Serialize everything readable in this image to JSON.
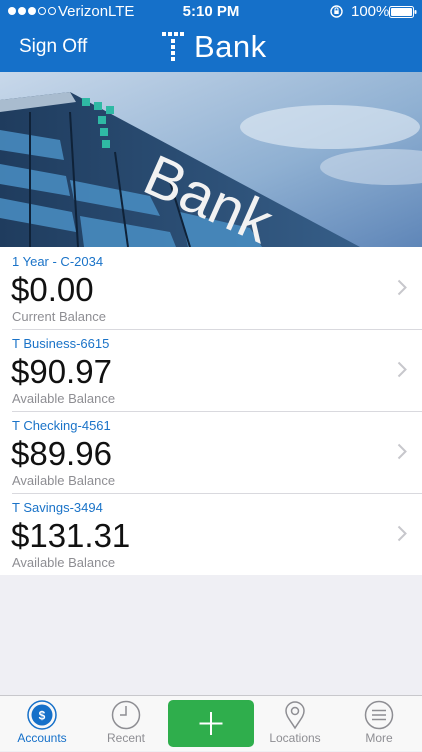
{
  "status_bar": {
    "carrier": "Verizon",
    "network": "LTE",
    "time": "5:10 PM",
    "battery": "100%"
  },
  "nav": {
    "sign_off_label": "Sign Off",
    "brand_name": "Bank"
  },
  "hero": {
    "sign_text": "Bank"
  },
  "accounts": [
    {
      "name": "1 Year - C-2034",
      "balance": "$0.00",
      "balance_label": "Current Balance"
    },
    {
      "name": "T Business-6615",
      "balance": "$90.97",
      "balance_label": "Available Balance"
    },
    {
      "name": "T Checking-4561",
      "balance": "$89.96",
      "balance_label": "Available Balance"
    },
    {
      "name": "T Savings-3494",
      "balance": "$131.31",
      "balance_label": "Available Balance"
    }
  ],
  "tabbar": {
    "accounts": "Accounts",
    "recent": "Recent",
    "locations": "Locations",
    "more": "More"
  },
  "colors": {
    "header_blue": "#1570c9",
    "account_name_blue": "#1a73c8",
    "add_button_green": "#2fae4c",
    "brand_teal": "#2fb9a4"
  },
  "icons": {
    "accounts_tab": "dollar-circle-icon",
    "recent_tab": "clock-icon",
    "add": "plus-icon",
    "locations_tab": "map-pin-icon",
    "more_tab": "menu-icon",
    "row_arrow": "chevron-right-icon"
  }
}
